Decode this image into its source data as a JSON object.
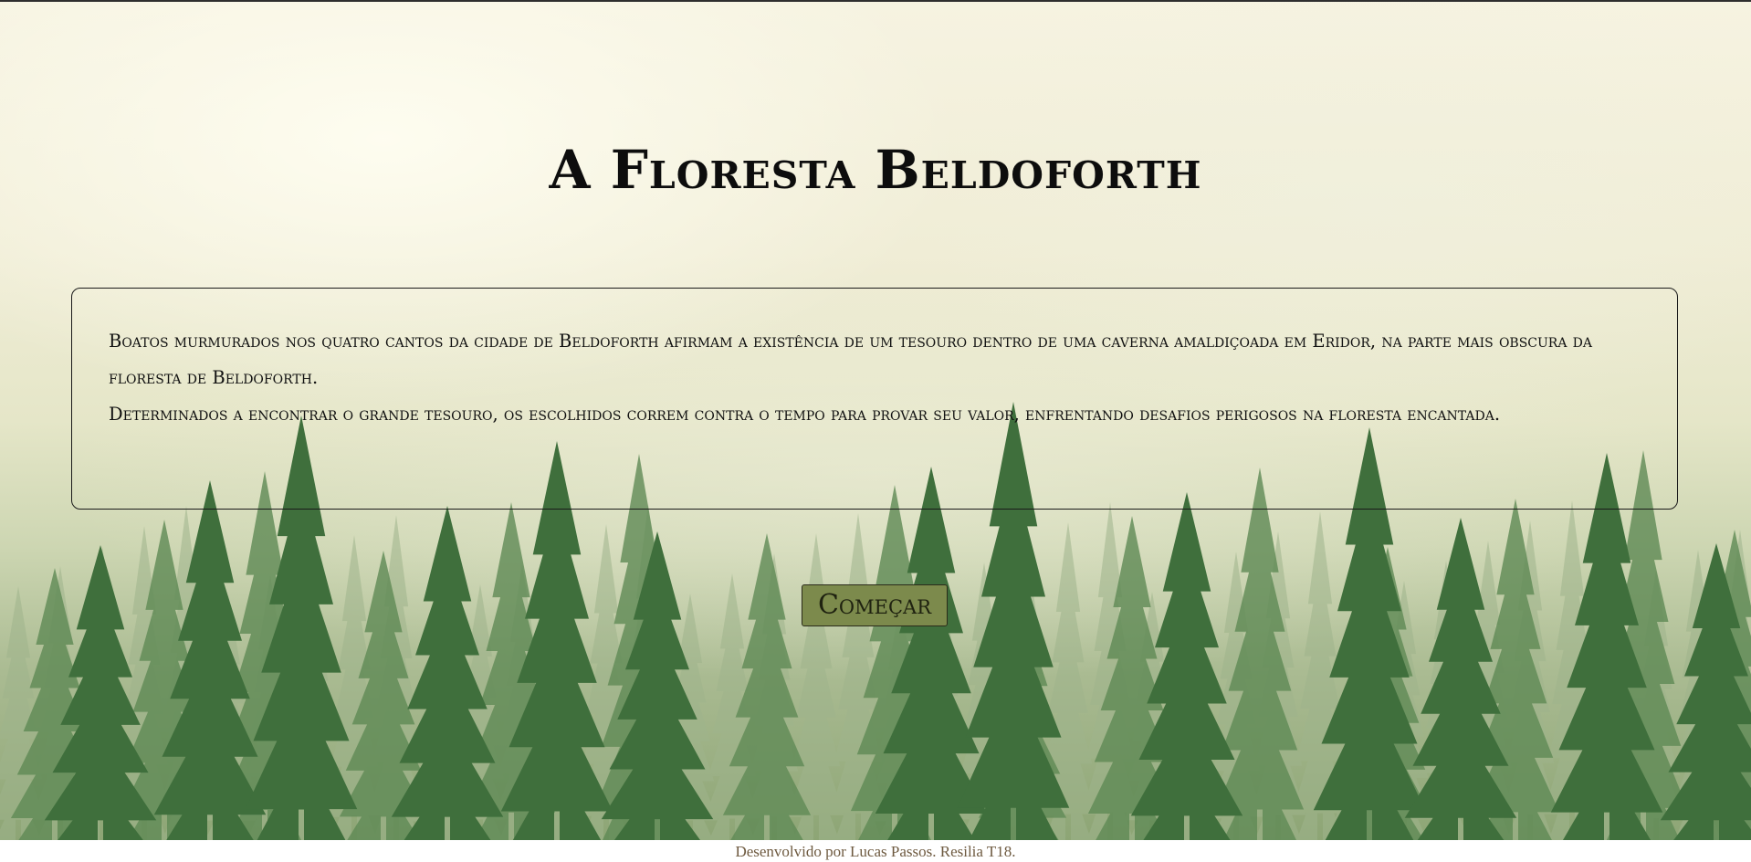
{
  "hero": {
    "title": "A Floresta Beldoforth",
    "story": [
      "Boatos murmurados nos quatro cantos da cidade de Beldoforth afirmam a existência de um tesouro dentro de uma caverna amaldiçoada em Eridor, na parte mais obscura da floresta de Beldoforth.",
      "Determinados a encontrar o grande tesouro, os escolhidos correm contra o tempo para provar seu valor, enfrentando desafios perigosos na floresta encantada."
    ],
    "start_label": "Começar"
  },
  "footer": {
    "credit": "Desenvolvido por Lucas Passos. Resilia T18."
  },
  "colors": {
    "button_bg": "#7c8a4c",
    "title_text": "#0d0d0d",
    "footer_text": "#6e5a40"
  },
  "background_image": "misty-pine-forest"
}
